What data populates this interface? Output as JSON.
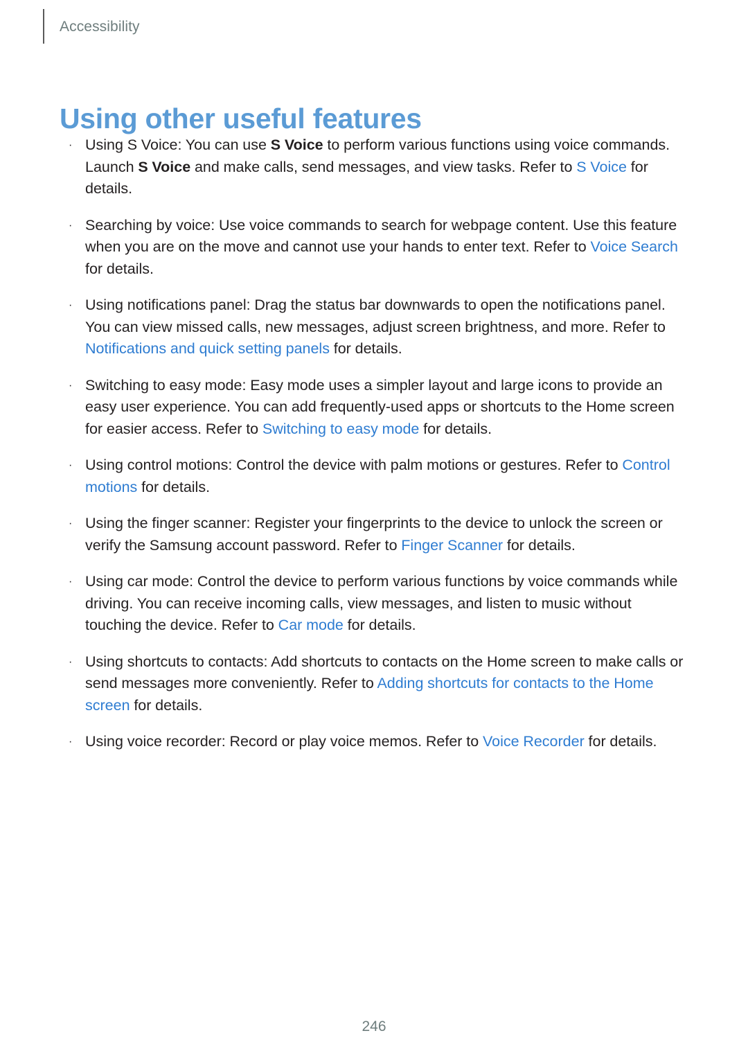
{
  "colors": {
    "title_blue": "#5b9bd5",
    "link_blue": "#2e7cd1",
    "header_gray": "#6e7d7d",
    "body_black": "#231f20",
    "rule_gray": "#5a5a5a"
  },
  "header": {
    "label": "Accessibility",
    "rule_icon": "vertical-rule-icon"
  },
  "title": "Using other useful features",
  "bullets": [
    {
      "marker": "·",
      "parts": [
        {
          "text": "Using S Voice: You can use ",
          "style": "normal"
        },
        {
          "text": "S Voice",
          "style": "bold"
        },
        {
          "text": " to perform various functions using voice commands. Launch ",
          "style": "normal"
        },
        {
          "text": "S Voice",
          "style": "bold"
        },
        {
          "text": " and make calls, send messages, and view tasks. Refer to ",
          "style": "normal"
        },
        {
          "text": "S Voice",
          "style": "link"
        },
        {
          "text": " for details.",
          "style": "normal"
        }
      ]
    },
    {
      "marker": "·",
      "parts": [
        {
          "text": "Searching by voice: Use voice commands to search for webpage content. Use this feature when you are on the move and cannot use your hands to enter text. Refer to ",
          "style": "normal"
        },
        {
          "text": "Voice Search",
          "style": "link"
        },
        {
          "text": " for details.",
          "style": "normal"
        }
      ]
    },
    {
      "marker": "·",
      "parts": [
        {
          "text": "Using notifications panel: Drag the status bar downwards to open the notifications panel. You can view missed calls, new messages, adjust screen brightness, and more. Refer to ",
          "style": "normal"
        },
        {
          "text": "Notifications and quick setting panels",
          "style": "link"
        },
        {
          "text": " for details.",
          "style": "normal"
        }
      ]
    },
    {
      "marker": "·",
      "parts": [
        {
          "text": "Switching to easy mode: Easy mode uses a simpler layout and large icons to provide an easy user experience. You can add frequently-used apps or shortcuts to the Home screen for easier access. Refer to ",
          "style": "normal"
        },
        {
          "text": "Switching to easy mode",
          "style": "link"
        },
        {
          "text": " for details.",
          "style": "normal"
        }
      ]
    },
    {
      "marker": "·",
      "parts": [
        {
          "text": "Using control motions: Control the device with palm motions or gestures. Refer to ",
          "style": "normal"
        },
        {
          "text": "Control motions",
          "style": "link"
        },
        {
          "text": " for details.",
          "style": "normal"
        }
      ]
    },
    {
      "marker": "·",
      "parts": [
        {
          "text": "Using the finger scanner: Register your fingerprints to the device to unlock the screen or verify the Samsung account password. Refer to ",
          "style": "normal"
        },
        {
          "text": "Finger Scanner",
          "style": "link"
        },
        {
          "text": " for details.",
          "style": "normal"
        }
      ]
    },
    {
      "marker": "·",
      "parts": [
        {
          "text": "Using car mode: Control the device to perform various functions by voice commands while driving. You can receive incoming calls, view messages, and listen to music without touching the device. Refer to ",
          "style": "normal"
        },
        {
          "text": "Car mode",
          "style": "link"
        },
        {
          "text": " for details.",
          "style": "normal"
        }
      ]
    },
    {
      "marker": "·",
      "parts": [
        {
          "text": "Using shortcuts to contacts: Add shortcuts to contacts on the Home screen to make calls or send messages more conveniently. Refer to ",
          "style": "normal"
        },
        {
          "text": "Adding shortcuts for contacts to the Home screen",
          "style": "link"
        },
        {
          "text": " for details.",
          "style": "normal"
        }
      ]
    },
    {
      "marker": "·",
      "parts": [
        {
          "text": "Using voice recorder: Record or play voice memos. Refer to ",
          "style": "normal"
        },
        {
          "text": "Voice Recorder",
          "style": "link"
        },
        {
          "text": " for details.",
          "style": "normal"
        }
      ]
    }
  ],
  "page_number": "246"
}
